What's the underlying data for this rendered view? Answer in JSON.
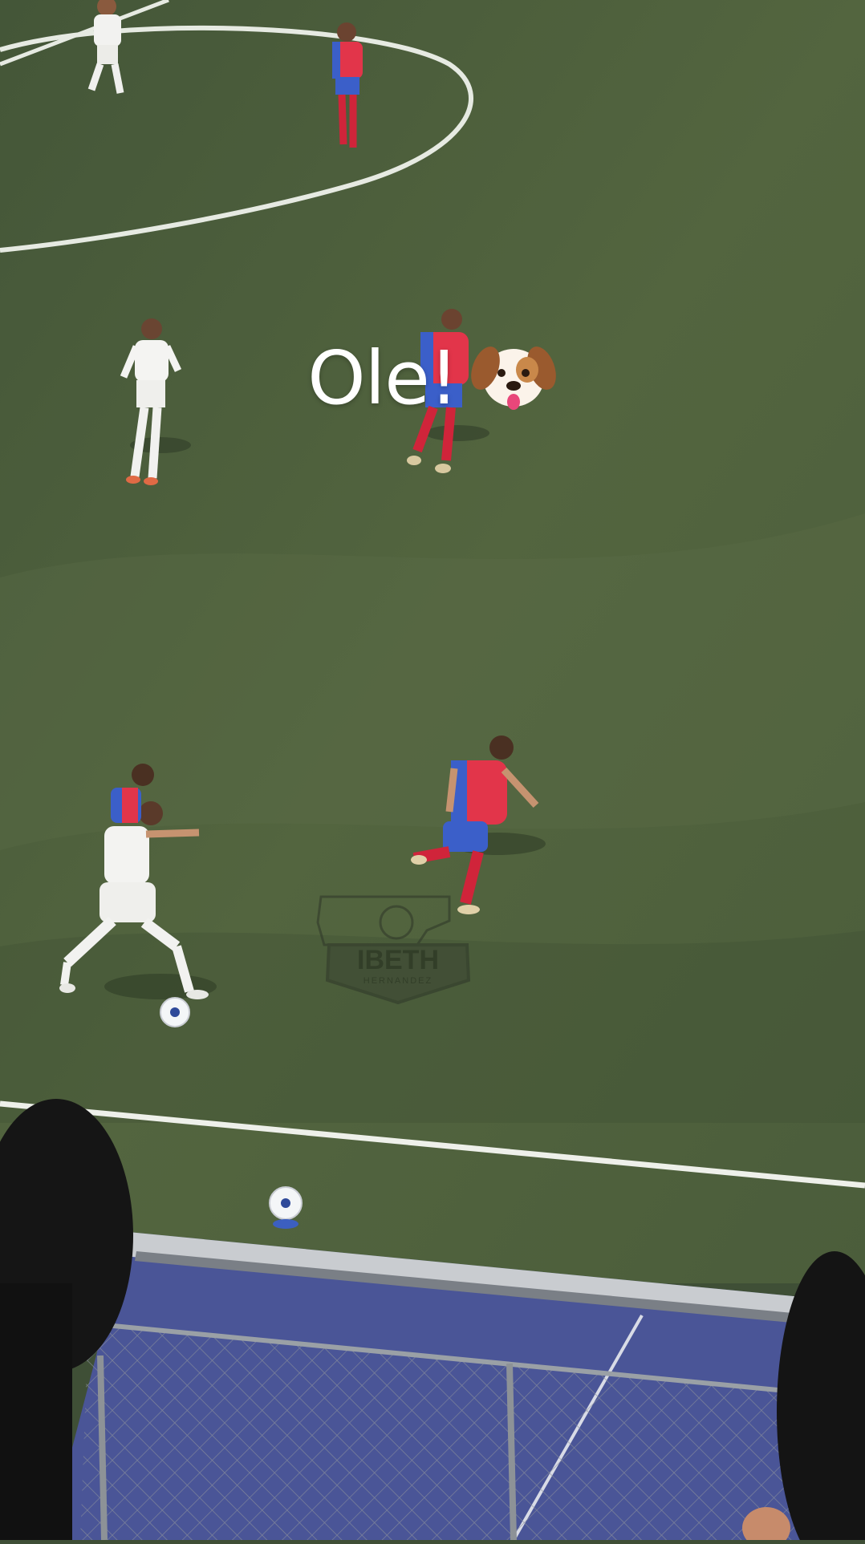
{
  "overlay": {
    "caption_text": "Ole!",
    "caption_emoji": "dog-face-icon"
  },
  "watermark": {
    "name": "IBETH",
    "subname": "HERNANDEZ"
  },
  "colors": {
    "pitch": "#4a5c3c",
    "pitch_light": "#5a6c48",
    "line": "#e8ece6",
    "kit_home": "#f2f2f0",
    "kit_away_red": "#e2354a",
    "kit_away_blue": "#3b5fc9",
    "track": "#3b4a8a"
  }
}
